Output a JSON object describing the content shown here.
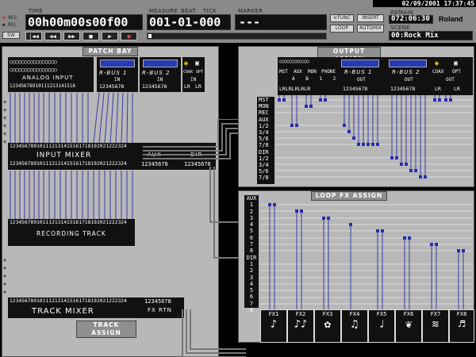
{
  "top": {
    "date": "02/09/2001 17:37:45",
    "brand": "Roland",
    "time_label": "TIME",
    "time_value": "00h00m00s00f00",
    "measure_label": "MEASURE",
    "beat_label": "BEAT",
    "tick_label": "TICK",
    "measure_value": "001-01-000",
    "marker_label": "MARKER",
    "marker_value": "---",
    "remain_label": "REMAIN",
    "remain_value": "072:06:30",
    "scene_label": "SCENE",
    "scene_value": "00:Rock Mix",
    "aes_label": "AES",
    "rel_label": "REL",
    "sw_label": "SW",
    "ind_buttons": [
      "V.FUNC",
      "INSERT",
      "LOOP",
      "AUTOMIX"
    ],
    "transport": [
      "|◀◀",
      "◀◀",
      "▶▶",
      "■",
      "▶",
      "●"
    ]
  },
  "patch_bay": {
    "title": "PATCH BAY",
    "analog_input": "ANALOG INPUT",
    "analog_nums": "12345678910111213141516",
    "rbus1": "R-BUS 1",
    "rbus2": "R-BUS 2",
    "coax": "COAX",
    "opt": "OPT",
    "in_label": "IN",
    "rbus_nums": "12345678",
    "lr": "LR",
    "input_mixer_nums": "123456789101112131415161718192021222324",
    "input_mixer": "INPUT MIXER",
    "aux": "AUX",
    "dir": "DIR",
    "aux_nums": "12345678",
    "recording_track": "RECORDING TRACK",
    "track_nums": "123456789101112131415161718192021222324",
    "track_mixer": "TRACK MIXER",
    "fx_rtn": "FX RTN",
    "fx_rtn_nums": "12345678",
    "track_assign": "TRACK ASSIGN"
  },
  "output_assign": {
    "title": "OUTPUT ASSIGN",
    "col_labels": [
      "MST",
      "AUX",
      "MON",
      "PHONE"
    ],
    "sub_labels": "A B 1 2",
    "rbus1": "R-BUS 1",
    "rbus2": "R-BUS 2",
    "coax": "COAX",
    "opt": "OPT",
    "out_label": "OUT",
    "out_nums": "12345678",
    "lr": "LR",
    "rows": [
      "MST",
      "MON",
      "REC",
      "AUX",
      "1/2",
      "3/4",
      "5/6",
      "7/8",
      "DIR",
      "1/2",
      "3/4",
      "5/6",
      "7/8"
    ]
  },
  "loop_fx": {
    "title": "LOOP FX ASSIGN",
    "aux_label": "AUX",
    "dir_label": "DIR",
    "nums": [
      "1",
      "2",
      "3",
      "4",
      "5",
      "6",
      "7",
      "8"
    ],
    "fx": [
      "FX1",
      "FX2",
      "FX3",
      "FX4",
      "FX5",
      "FX6",
      "FX7",
      "FX8"
    ]
  },
  "colors": {
    "background": "#000000",
    "panel": "#b8b8b8",
    "line": "#3a3aa8",
    "header": "#8a8a8a"
  }
}
